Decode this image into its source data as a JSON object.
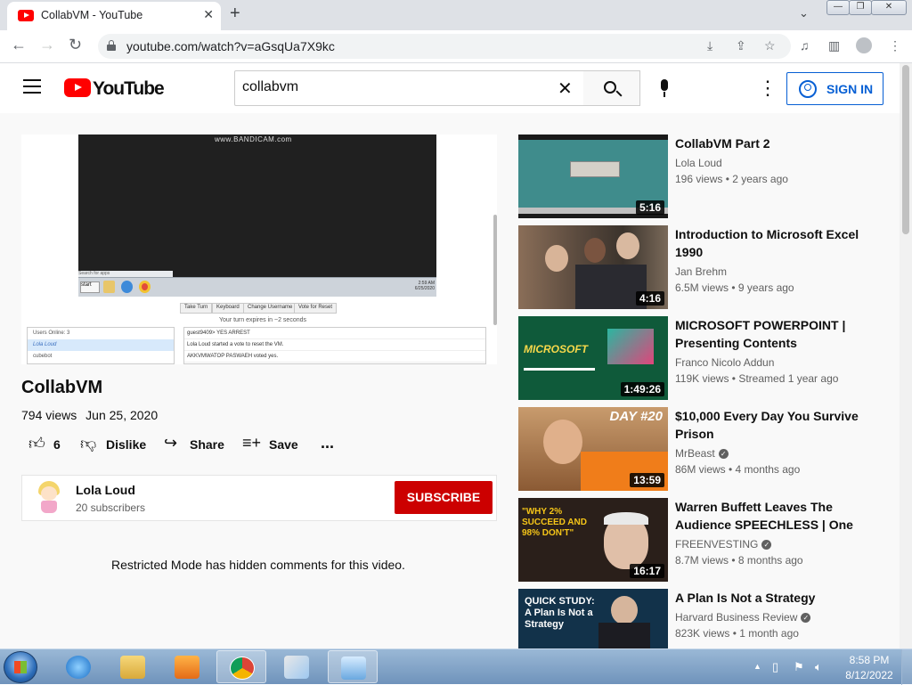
{
  "browser": {
    "tab_title": "CollabVM - YouTube",
    "tab_close": "✕",
    "new_tab": "+",
    "tab_menu": "⌄",
    "url": "youtube.com/watch?v=aGsqUa7X9kc",
    "back": "←",
    "forward": "→",
    "reload": "↻"
  },
  "youtube": {
    "logo_text": "YouTube",
    "search_value": "collabvm",
    "sign_in": "SIGN IN"
  },
  "player": {
    "watermark": "www.BANDICAM.com",
    "buttons": [
      "Take Turn",
      "Keyboard",
      "Change Username",
      "Vote for Reset"
    ],
    "turn_text": "Your turn expires in ~2 seconds",
    "users": [
      "Users Online: 3",
      "Lola Loud",
      "cubebot"
    ],
    "chat": [
      "guest9409> YES ARREST",
      "Lola Loud started a vote to reset the VM.",
      "AKKVMWATOP PASWAEH voted yes."
    ],
    "clock_time": "2:59 AM",
    "clock_date": "6/25/2020",
    "start_label": "start"
  },
  "video": {
    "title": "CollabVM",
    "views": "794 views",
    "date": "Jun 25, 2020",
    "likes": "6",
    "dislike": "Dislike",
    "share": "Share",
    "save": "Save",
    "more": "..."
  },
  "channel": {
    "name": "Lola Loud",
    "subscribers": "20 subscribers",
    "subscribe": "SUBSCRIBE"
  },
  "comments_notice": "Restricted Mode has hidden comments for this video.",
  "recommendations": [
    {
      "title": "CollabVM Part 2",
      "channel": "Lola Loud",
      "verified": false,
      "meta": "196 views • 2 years ago",
      "duration": "5:16",
      "color": "#3f8c8c"
    },
    {
      "title": "Introduction to Microsoft Excel 1990",
      "channel": "Jan Brehm",
      "verified": false,
      "meta": "6.5M views • 9 years ago",
      "duration": "4:16",
      "color": "#6b5444"
    },
    {
      "title": "MICROSOFT POWERPOINT | Presenting Contents Effectivel…",
      "channel": "Franco Nicolo Addun",
      "verified": false,
      "meta": "119K views • Streamed 1 year ago",
      "duration": "1:49:26",
      "color": "#0f5a3a",
      "thumb_text": "MICROSOFT"
    },
    {
      "title": "$10,000 Every Day You Survive Prison",
      "channel": "MrBeast",
      "verified": true,
      "meta": "86M views • 4 months ago",
      "duration": "13:59",
      "color": "#b06a3a",
      "thumb_text": "DAY #20"
    },
    {
      "title": "Warren Buffett Leaves The Audience SPEECHLESS | One …",
      "channel": "FREENVESTING",
      "verified": true,
      "meta": "8.7M views • 8 months ago",
      "duration": "16:17",
      "color": "#3a2a22",
      "thumb_text": "\"WHY 2% SUCCEED AND 98% DON'T\""
    },
    {
      "title": "A Plan Is Not a Strategy",
      "channel": "Harvard Business Review",
      "verified": true,
      "meta": "823K views • 1 month ago",
      "duration": "",
      "color": "#12324a",
      "thumb_text": "QUICK STUDY: A Plan Is Not a Strategy"
    }
  ],
  "taskbar": {
    "time": "8:58 PM",
    "date": "8/12/2022"
  }
}
